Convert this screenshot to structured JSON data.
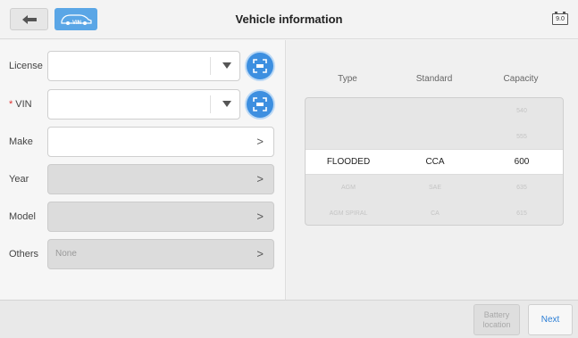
{
  "header": {
    "title": "Vehicle information",
    "logo_text": "VIN",
    "battery_indicator": "9.0"
  },
  "form": {
    "fields": [
      {
        "label": "License",
        "value": "",
        "required": false,
        "kind": "dropdown",
        "state": "enabled"
      },
      {
        "label": "VIN",
        "value": "",
        "required": true,
        "kind": "dropdown",
        "state": "enabled"
      },
      {
        "label": "Make",
        "value": "",
        "required": false,
        "kind": "chevron",
        "state": "enabled"
      },
      {
        "label": "Year",
        "value": "",
        "required": false,
        "kind": "chevron",
        "state": "disabled"
      },
      {
        "label": "Model",
        "value": "",
        "required": false,
        "kind": "chevron",
        "state": "disabled"
      },
      {
        "label": "Others",
        "value": "None",
        "required": false,
        "kind": "chevron",
        "state": "disabled"
      }
    ],
    "required_marker": "*",
    "chevron": ">"
  },
  "battery_table": {
    "columns": [
      "Type",
      "Standard",
      "Capacity"
    ],
    "rows": [
      [
        "",
        "",
        "540"
      ],
      [
        "",
        "",
        "555"
      ],
      [
        "FLOODED",
        "CCA",
        "600"
      ],
      [
        "AGM",
        "SAE",
        "635"
      ],
      [
        "AGM SPIRAL",
        "CA",
        "615"
      ]
    ],
    "selected_row": 2
  },
  "footer": {
    "battery_location_line1": "Battery",
    "battery_location_line2": "location",
    "next_label": "Next"
  }
}
